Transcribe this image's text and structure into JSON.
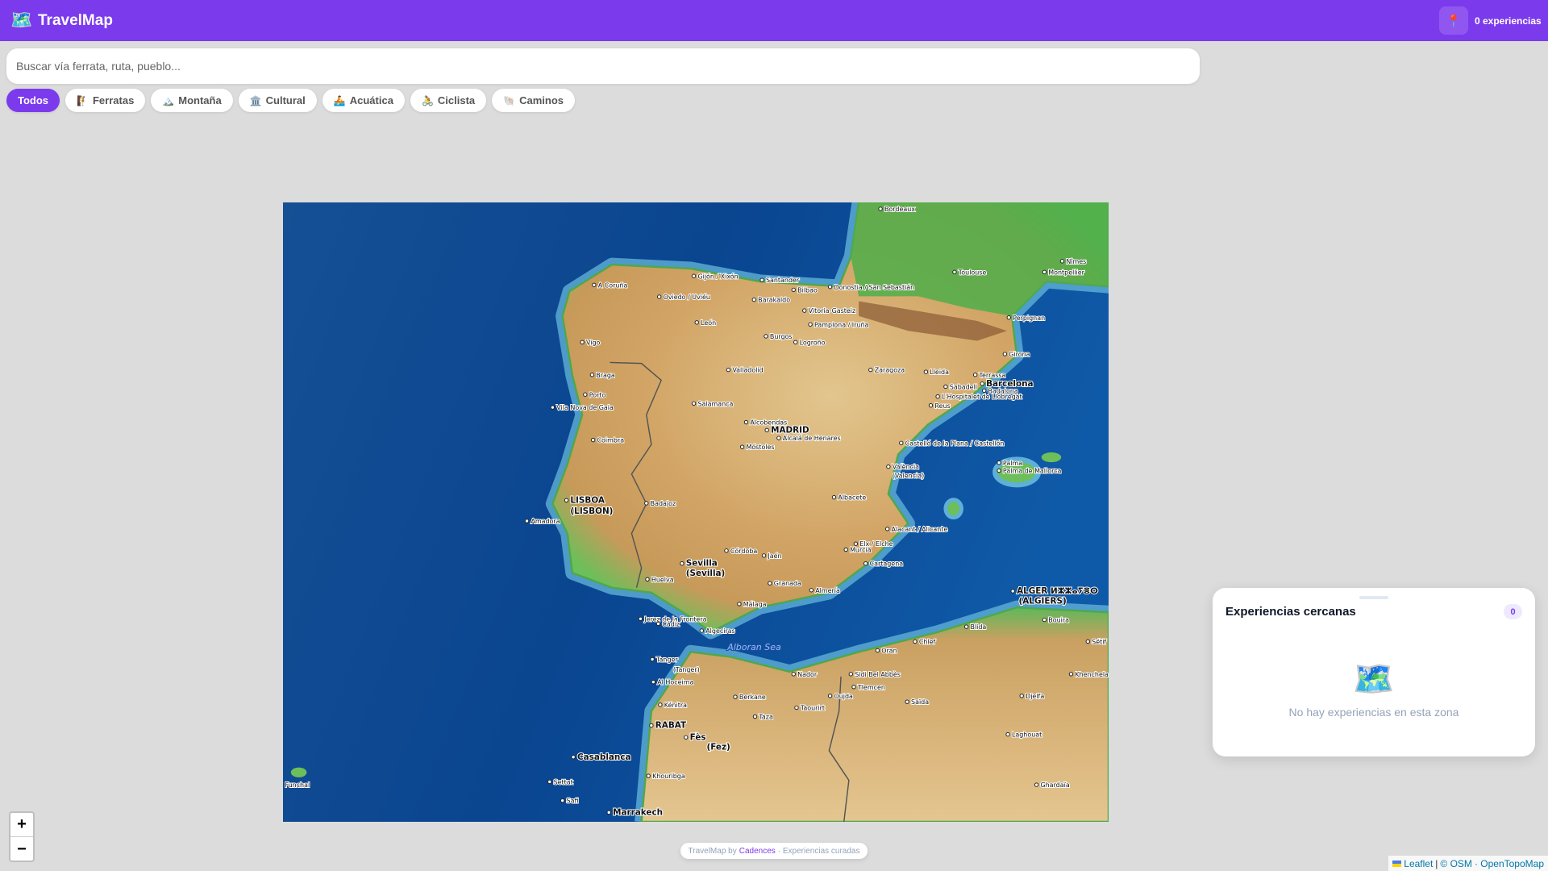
{
  "header": {
    "logo_icon": "world-map-icon",
    "logo_glyph": "🗺️",
    "title": "TravelMap",
    "pin_glyph": "📍",
    "experience_count": "0 experiencias"
  },
  "search": {
    "placeholder": "Buscar vía ferrata, ruta, pueblo...",
    "value": ""
  },
  "filters": [
    {
      "label": "Todos",
      "icon": "",
      "active": true
    },
    {
      "label": "Ferratas",
      "icon": "🧗",
      "active": false
    },
    {
      "label": "Montaña",
      "icon": "🏔️",
      "active": false
    },
    {
      "label": "Cultural",
      "icon": "🏛️",
      "active": false
    },
    {
      "label": "Acuática",
      "icon": "🚣",
      "active": false
    },
    {
      "label": "Ciclista",
      "icon": "🚴",
      "active": false
    },
    {
      "label": "Caminos",
      "icon": "🐚",
      "active": false
    }
  ],
  "colors": {
    "brand": "#7c3aed",
    "badge_bg": "#ede9fe",
    "ocean": "#0d4a94",
    "land": "#d8b478"
  },
  "map": {
    "sea_label": "Alboran Sea",
    "cities": [
      "Bordeaux",
      "Toulouse",
      "Nîmes",
      "Montpellier",
      "A Coruña",
      "Gijón / Xixón",
      "Santander",
      "Bilbao",
      "Donostia / San Sebastián",
      "Oviedo / Uviéu",
      "Barakaldo",
      "Vitoria-Gasteiz",
      "Pamplona / Iruña",
      "Perpignan",
      "León",
      "Burgos",
      "Logroño",
      "Vigo",
      "Girona",
      "Valladolid",
      "Zaragoza",
      "Lleida",
      "Terrassa",
      "Braga",
      "Barcelona",
      "Sabadell",
      "Badalona",
      "L'Hospitalet de Llobregat",
      "Porto",
      "Reus",
      "Vila Nova de Gaia",
      "Salamanca",
      "Alcobendas",
      "MADRID",
      "Alcalá de Henares",
      "Coimbra",
      "Castelló de la Plana / Castellón",
      "Móstoles",
      "Palma",
      "Palma de Mallorca",
      "València",
      "(Valencia)",
      "LISBOA",
      "(LISBON)",
      "Badajoz",
      "Albacete",
      "Amadora",
      "Alacant / Alicante",
      "Córdoba",
      "Elx / Elche",
      "Murcia",
      "Jaén",
      "Sevilla",
      "(Sevilla)",
      "Cartagena",
      "Granada",
      "Huelva",
      "Almería",
      "ALGER ⵍⵣⵣⴰⵢⴻⵔ",
      "(ALGIERS)",
      "Málaga",
      "Jerez de la Frontera",
      "Cádiz",
      "Bouira",
      "Algeciras",
      "Blida",
      "Chlef",
      "Oran",
      "Tanger",
      "(Tanger)",
      "Sidi Bel Abbès",
      "Al Hoceima",
      "Nador",
      "Tlemcen",
      "Berkane",
      "Oujda",
      "Saïda",
      "Kénitra",
      "Taourirt",
      "Djelfa",
      "Taza",
      "RABAT",
      "Fès",
      "(Fez)",
      "Laghouat",
      "Casablanca",
      "Khouribga",
      "Settat",
      "Ghardaïa",
      "Safi",
      "Marrakech",
      "Funchal",
      "Khenchela",
      "Sétif"
    ]
  },
  "panel": {
    "title": "Experiencias cercanas",
    "count": "0",
    "empty_icon": "🗺️",
    "empty_text": "No hay experiencias en esta zona"
  },
  "zoom": {
    "in": "+",
    "out": "−"
  },
  "footer": {
    "prefix": "TravelMap by",
    "author": "Cadences",
    "suffix": "· Experiencias curadas"
  },
  "attribution": {
    "leaflet": "Leaflet",
    "sep": "|",
    "osm": "© OSM",
    "opentopo": "· OpenTopoMap"
  }
}
